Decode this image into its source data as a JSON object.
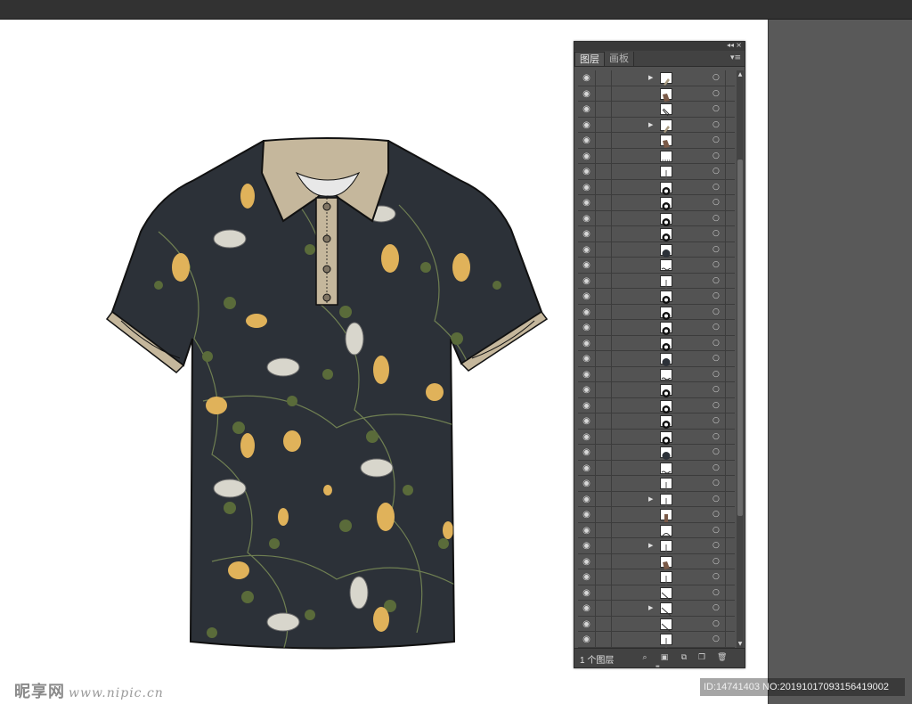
{
  "panel": {
    "tabs": [
      {
        "label": "图层",
        "active": true
      },
      {
        "label": "画板",
        "active": false
      }
    ],
    "layer_count": "1 个图层",
    "rows": [
      {
        "expand": true,
        "thumb": "beige-swatch"
      },
      {
        "expand": false,
        "thumb": "brown-swatch"
      },
      {
        "expand": false,
        "thumb": "outline-path"
      },
      {
        "expand": true,
        "thumb": "beige-swatch"
      },
      {
        "expand": false,
        "thumb": "brown-swatch"
      },
      {
        "expand": false,
        "thumb": "dashed-line"
      },
      {
        "expand": false,
        "thumb": "line"
      },
      {
        "expand": false,
        "thumb": "button-ring"
      },
      {
        "expand": false,
        "thumb": "button-ring"
      },
      {
        "expand": false,
        "thumb": "button-ring"
      },
      {
        "expand": false,
        "thumb": "button-ring"
      },
      {
        "expand": false,
        "thumb": "dark-circle"
      },
      {
        "expand": false,
        "thumb": "stitch-line"
      },
      {
        "expand": false,
        "thumb": "line"
      },
      {
        "expand": false,
        "thumb": "button-ring"
      },
      {
        "expand": false,
        "thumb": "button-ring"
      },
      {
        "expand": false,
        "thumb": "button-ring"
      },
      {
        "expand": false,
        "thumb": "button-ring"
      },
      {
        "expand": false,
        "thumb": "dark-circle"
      },
      {
        "expand": false,
        "thumb": "stitch-line"
      },
      {
        "expand": false,
        "thumb": "button-ring"
      },
      {
        "expand": false,
        "thumb": "button-ring"
      },
      {
        "expand": false,
        "thumb": "button-ring"
      },
      {
        "expand": false,
        "thumb": "button-ring"
      },
      {
        "expand": false,
        "thumb": "dark-circle"
      },
      {
        "expand": false,
        "thumb": "stitch-line"
      },
      {
        "expand": false,
        "thumb": "line"
      },
      {
        "expand": true,
        "thumb": "line"
      },
      {
        "expand": false,
        "thumb": "brown-bar"
      },
      {
        "expand": false,
        "thumb": "arc"
      },
      {
        "expand": true,
        "thumb": "line"
      },
      {
        "expand": false,
        "thumb": "brown-swatch"
      },
      {
        "expand": false,
        "thumb": "line"
      },
      {
        "expand": false,
        "thumb": "diagonal"
      },
      {
        "expand": true,
        "thumb": "diagonal"
      },
      {
        "expand": false,
        "thumb": "diagonal"
      },
      {
        "expand": false,
        "thumb": "line"
      }
    ]
  },
  "watermark": {
    "left": "昵享网",
    "left_url": "www.nipic.cn",
    "right": "ID:14741403 NO:20191017093156419002"
  },
  "colors": {
    "shirt_body": "#2c3138",
    "collar": "#c5b79c",
    "leaf": "#5a6b3a",
    "flower": "#e0b25a",
    "panel_bg": "#535353"
  },
  "icons": {
    "visibility": "eye-icon",
    "target": "target-circle-icon",
    "search": "search-icon",
    "new_layer": "new-layer-icon",
    "delete": "trash-icon"
  }
}
